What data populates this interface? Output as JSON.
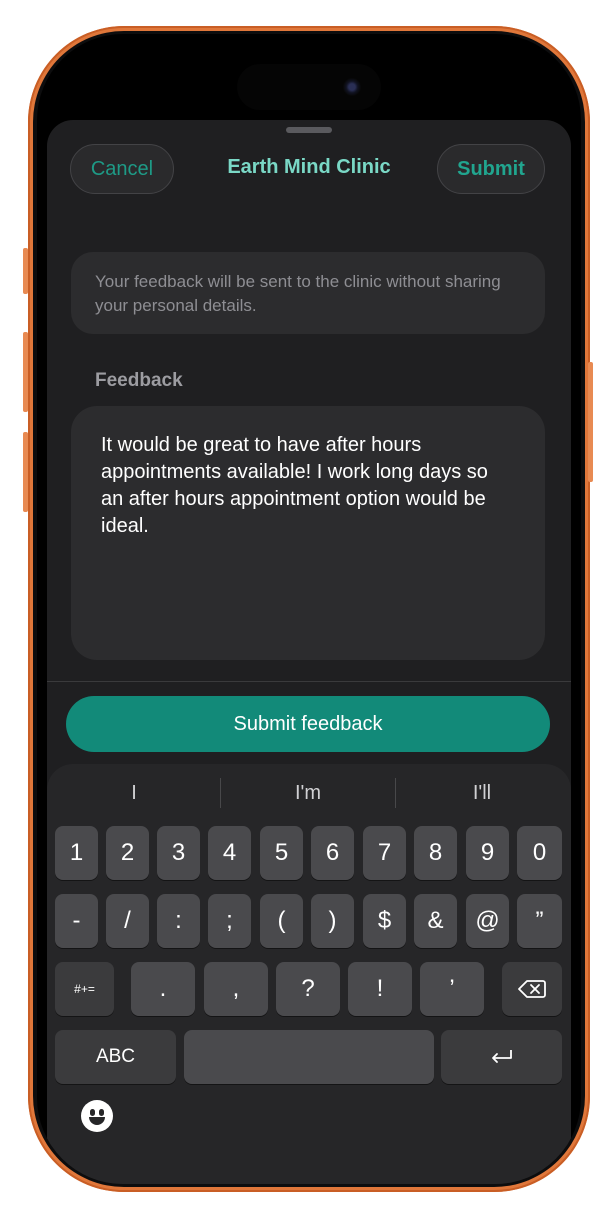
{
  "header": {
    "cancel_label": "Cancel",
    "title": "Earth Mind Clinic",
    "submit_label": "Submit"
  },
  "notice": {
    "text": "Your feedback will be sent to the clinic without sharing your personal details."
  },
  "feedback": {
    "label": "Feedback",
    "value": "It would be great to have after hours appointments available! I work long days so an after hours appointment option would be ideal."
  },
  "submit_button": {
    "label": "Submit feedback"
  },
  "keyboard": {
    "suggestions": [
      "I",
      "I'm",
      "I'll"
    ],
    "row1": [
      "1",
      "2",
      "3",
      "4",
      "5",
      "6",
      "7",
      "8",
      "9",
      "0"
    ],
    "row2": [
      "-",
      "/",
      ":",
      ";",
      "(",
      ")",
      "$",
      "&",
      "@",
      "”"
    ],
    "row3": [
      ".",
      ",",
      "?",
      "!",
      "’"
    ],
    "symbols_label": "#+=",
    "abc_label": "ABC",
    "delete_icon": "delete-backward-icon",
    "return_icon": "return-icon",
    "emoji_icon": "emoji-icon"
  },
  "colors": {
    "accent": "#128a79",
    "title": "#7ad8c6",
    "frame": "#e0773a"
  }
}
